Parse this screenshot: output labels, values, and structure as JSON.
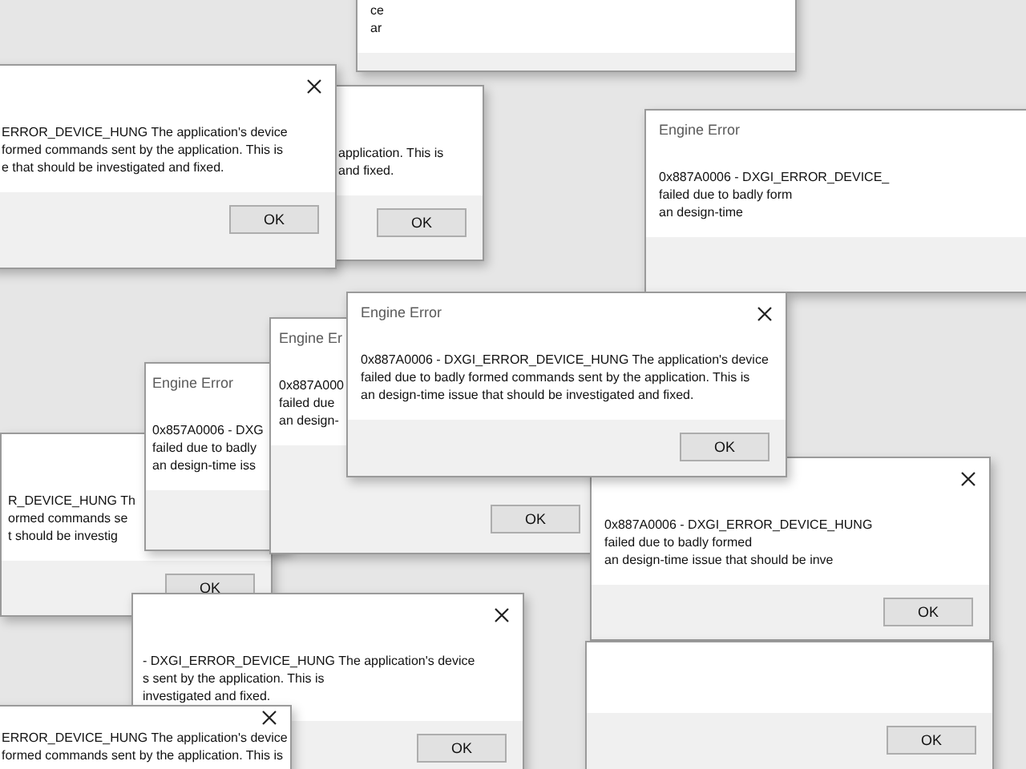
{
  "windows": [
    {
      "message": [
        "ce",
        "ar"
      ]
    },
    {
      "close_button": true,
      "message": [
        "ERROR_DEVICE_HUNG The application's device",
        "formed commands sent by the application. This is",
        "e that should be investigated and fixed."
      ],
      "button": "OK"
    },
    {
      "message": [
        "application. This is",
        "and fixed."
      ],
      "button": "OK"
    },
    {
      "title": "Engine Error",
      "message": [
        "0x887A0006 - DXGI_ERROR_DEVICE_",
        "failed due to badly form",
        "an design-time"
      ]
    },
    {
      "message": [
        "R_DEVICE_HUNG Th",
        "ormed commands se",
        "t should be investig"
      ],
      "button": "OK"
    },
    {
      "title": "Engine Error",
      "message": [
        "0x857A0006 - DXG",
        "failed due to badly",
        "an design-time iss"
      ]
    },
    {
      "title": "Engine Er",
      "message": [
        "0x887A000",
        "failed due",
        "an design-"
      ],
      "button": "OK"
    },
    {
      "close_button": true,
      "message": [
        "0x887A0006 - DXGI_ERROR_DEVICE_HUNG",
        "failed due to badly formed",
        "an design-time issue that should be inve"
      ],
      "button": "OK"
    },
    {
      "button": "OK"
    },
    {
      "close_button": true,
      "message": [
        "- DXGI_ERROR_DEVICE_HUNG The application's device",
        "s sent by the application. This is",
        "investigated and fixed."
      ],
      "button": "OK"
    },
    {
      "close_button": true,
      "message": [
        "ERROR_DEVICE_HUNG The application's device",
        "formed commands sent by the application. This is"
      ]
    },
    {
      "title": "Engine Error",
      "close_button": true,
      "message": [
        "0x887A0006 - DXGI_ERROR_DEVICE_HUNG The application's device",
        "failed due to badly formed commands sent by the application. This is",
        "an design-time issue that should be investigated and fixed."
      ],
      "button": "OK"
    }
  ]
}
